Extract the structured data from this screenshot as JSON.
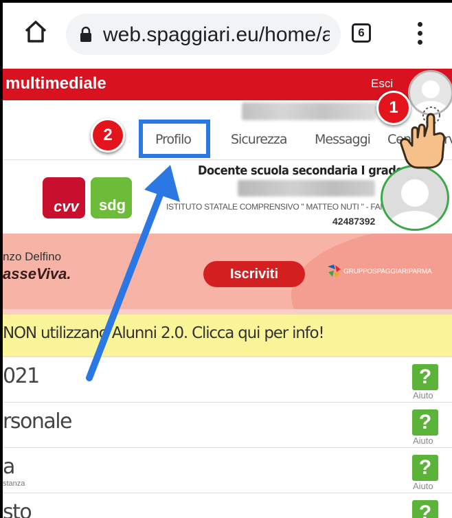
{
  "browser": {
    "url": "web.spaggiari.eu/home/app/",
    "tab_count": "6"
  },
  "header": {
    "title": "multimediale",
    "logout": "Esci"
  },
  "nav": {
    "items": [
      "Profilo",
      "Sicurezza",
      "Messaggi",
      "Centro servizi"
    ]
  },
  "annotations": {
    "step1": "1",
    "step2": "2"
  },
  "profile": {
    "role": "Docente scuola secondaria I grado",
    "school": "ISTITUTO STATALE COMPRENSIVO \" MATTEO NUTI \" - FANO",
    "code": "42487392",
    "logo_cvv": "cvv",
    "logo_sdg": "sdg"
  },
  "banner": {
    "line1": "nzo Delfino",
    "line2": "asseViva.",
    "cta": "Iscriviti",
    "brand": "GRUPPOSPAGGIARIPARMA"
  },
  "notice": "NON utilizzano Alunni 2.0. Clicca qui per info!",
  "list": [
    {
      "label": "021",
      "sub": "",
      "help": "?",
      "help_label": "Aiuto"
    },
    {
      "label": "rsonale",
      "sub": "",
      "help": "?",
      "help_label": "Aiuto"
    },
    {
      "label": "a",
      "sub": "stanza",
      "help": "?",
      "help_label": "Aiuto"
    },
    {
      "label": "sto",
      "sub": "",
      "help": "?",
      "help_label": ""
    }
  ],
  "colors": {
    "header_red": "#d8121e",
    "highlight_blue": "#2b78e4",
    "badge_red": "#e3141b",
    "help_green": "#5cb33a"
  }
}
